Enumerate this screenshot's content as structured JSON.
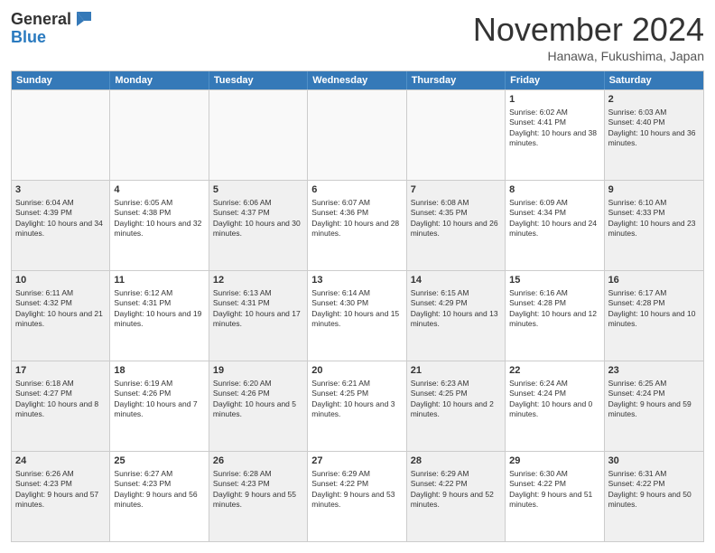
{
  "logo": {
    "line1": "General",
    "line2": "Blue"
  },
  "title": "November 2024",
  "location": "Hanawa, Fukushima, Japan",
  "header_days": [
    "Sunday",
    "Monday",
    "Tuesday",
    "Wednesday",
    "Thursday",
    "Friday",
    "Saturday"
  ],
  "weeks": [
    [
      {
        "day": "",
        "info": ""
      },
      {
        "day": "",
        "info": ""
      },
      {
        "day": "",
        "info": ""
      },
      {
        "day": "",
        "info": ""
      },
      {
        "day": "",
        "info": ""
      },
      {
        "day": "1",
        "info": "Sunrise: 6:02 AM\nSunset: 4:41 PM\nDaylight: 10 hours and 38 minutes."
      },
      {
        "day": "2",
        "info": "Sunrise: 6:03 AM\nSunset: 4:40 PM\nDaylight: 10 hours and 36 minutes."
      }
    ],
    [
      {
        "day": "3",
        "info": "Sunrise: 6:04 AM\nSunset: 4:39 PM\nDaylight: 10 hours and 34 minutes."
      },
      {
        "day": "4",
        "info": "Sunrise: 6:05 AM\nSunset: 4:38 PM\nDaylight: 10 hours and 32 minutes."
      },
      {
        "day": "5",
        "info": "Sunrise: 6:06 AM\nSunset: 4:37 PM\nDaylight: 10 hours and 30 minutes."
      },
      {
        "day": "6",
        "info": "Sunrise: 6:07 AM\nSunset: 4:36 PM\nDaylight: 10 hours and 28 minutes."
      },
      {
        "day": "7",
        "info": "Sunrise: 6:08 AM\nSunset: 4:35 PM\nDaylight: 10 hours and 26 minutes."
      },
      {
        "day": "8",
        "info": "Sunrise: 6:09 AM\nSunset: 4:34 PM\nDaylight: 10 hours and 24 minutes."
      },
      {
        "day": "9",
        "info": "Sunrise: 6:10 AM\nSunset: 4:33 PM\nDaylight: 10 hours and 23 minutes."
      }
    ],
    [
      {
        "day": "10",
        "info": "Sunrise: 6:11 AM\nSunset: 4:32 PM\nDaylight: 10 hours and 21 minutes."
      },
      {
        "day": "11",
        "info": "Sunrise: 6:12 AM\nSunset: 4:31 PM\nDaylight: 10 hours and 19 minutes."
      },
      {
        "day": "12",
        "info": "Sunrise: 6:13 AM\nSunset: 4:31 PM\nDaylight: 10 hours and 17 minutes."
      },
      {
        "day": "13",
        "info": "Sunrise: 6:14 AM\nSunset: 4:30 PM\nDaylight: 10 hours and 15 minutes."
      },
      {
        "day": "14",
        "info": "Sunrise: 6:15 AM\nSunset: 4:29 PM\nDaylight: 10 hours and 13 minutes."
      },
      {
        "day": "15",
        "info": "Sunrise: 6:16 AM\nSunset: 4:28 PM\nDaylight: 10 hours and 12 minutes."
      },
      {
        "day": "16",
        "info": "Sunrise: 6:17 AM\nSunset: 4:28 PM\nDaylight: 10 hours and 10 minutes."
      }
    ],
    [
      {
        "day": "17",
        "info": "Sunrise: 6:18 AM\nSunset: 4:27 PM\nDaylight: 10 hours and 8 minutes."
      },
      {
        "day": "18",
        "info": "Sunrise: 6:19 AM\nSunset: 4:26 PM\nDaylight: 10 hours and 7 minutes."
      },
      {
        "day": "19",
        "info": "Sunrise: 6:20 AM\nSunset: 4:26 PM\nDaylight: 10 hours and 5 minutes."
      },
      {
        "day": "20",
        "info": "Sunrise: 6:21 AM\nSunset: 4:25 PM\nDaylight: 10 hours and 3 minutes."
      },
      {
        "day": "21",
        "info": "Sunrise: 6:23 AM\nSunset: 4:25 PM\nDaylight: 10 hours and 2 minutes."
      },
      {
        "day": "22",
        "info": "Sunrise: 6:24 AM\nSunset: 4:24 PM\nDaylight: 10 hours and 0 minutes."
      },
      {
        "day": "23",
        "info": "Sunrise: 6:25 AM\nSunset: 4:24 PM\nDaylight: 9 hours and 59 minutes."
      }
    ],
    [
      {
        "day": "24",
        "info": "Sunrise: 6:26 AM\nSunset: 4:23 PM\nDaylight: 9 hours and 57 minutes."
      },
      {
        "day": "25",
        "info": "Sunrise: 6:27 AM\nSunset: 4:23 PM\nDaylight: 9 hours and 56 minutes."
      },
      {
        "day": "26",
        "info": "Sunrise: 6:28 AM\nSunset: 4:23 PM\nDaylight: 9 hours and 55 minutes."
      },
      {
        "day": "27",
        "info": "Sunrise: 6:29 AM\nSunset: 4:22 PM\nDaylight: 9 hours and 53 minutes."
      },
      {
        "day": "28",
        "info": "Sunrise: 6:29 AM\nSunset: 4:22 PM\nDaylight: 9 hours and 52 minutes."
      },
      {
        "day": "29",
        "info": "Sunrise: 6:30 AM\nSunset: 4:22 PM\nDaylight: 9 hours and 51 minutes."
      },
      {
        "day": "30",
        "info": "Sunrise: 6:31 AM\nSunset: 4:22 PM\nDaylight: 9 hours and 50 minutes."
      }
    ]
  ]
}
